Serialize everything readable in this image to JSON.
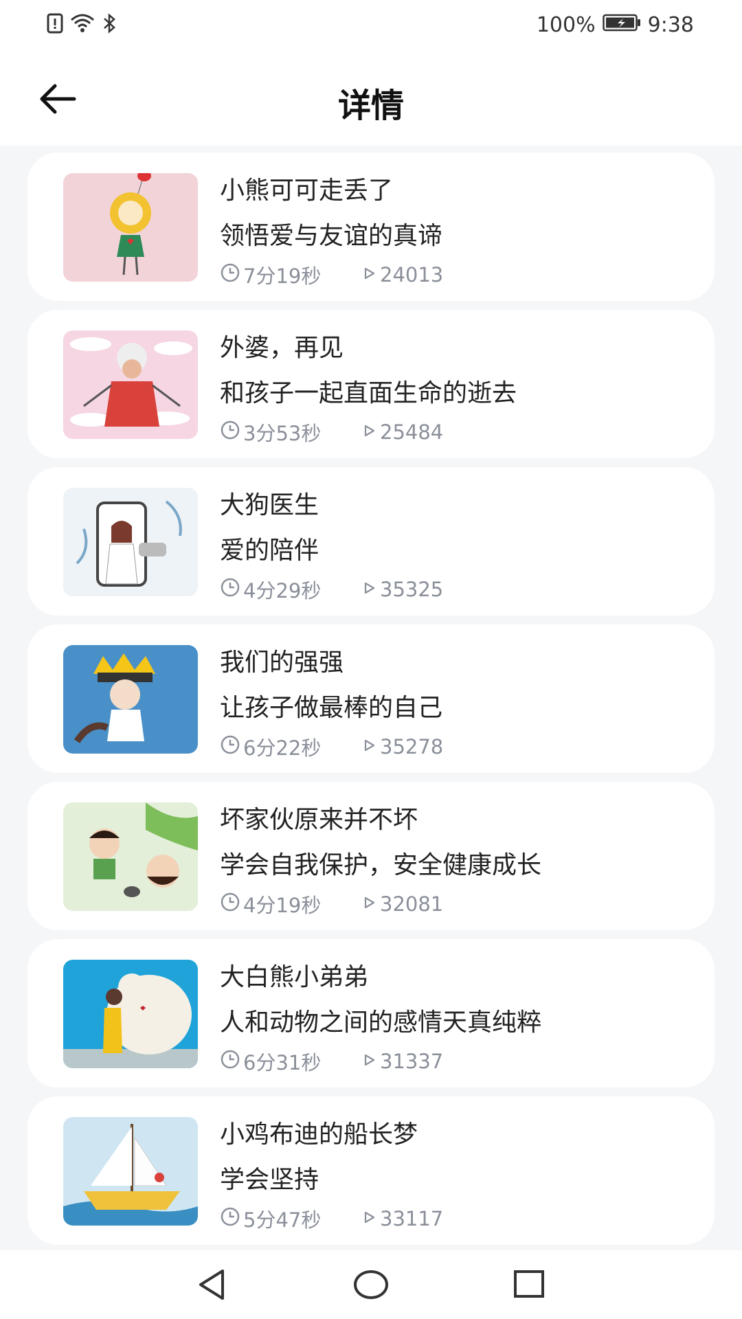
{
  "status_bar": {
    "battery": "100%",
    "time": "9:38",
    "icons": [
      "sim-alert-icon",
      "wifi-icon",
      "bluetooth-icon",
      "battery-icon"
    ]
  },
  "header": {
    "title": "详情",
    "back_icon": "arrow-left-icon"
  },
  "stories": [
    {
      "title": "小熊可可走丢了",
      "subtitle": "领悟爱与友谊的真谛",
      "duration": "7分19秒",
      "plays": "24013"
    },
    {
      "title": "外婆，再见",
      "subtitle": "和孩子一起直面生命的逝去",
      "duration": "3分53秒",
      "plays": "25484"
    },
    {
      "title": "大狗医生",
      "subtitle": "爱的陪伴",
      "duration": "4分29秒",
      "plays": "35325"
    },
    {
      "title": "我们的强强",
      "subtitle": "让孩子做最棒的自己",
      "duration": "6分22秒",
      "plays": "35278"
    },
    {
      "title": "坏家伙原来并不坏",
      "subtitle": "学会自我保护，安全健康成长",
      "duration": "4分19秒",
      "plays": "32081"
    },
    {
      "title": "大白熊小弟弟",
      "subtitle": "人和动物之间的感情天真纯粹",
      "duration": "6分31秒",
      "plays": "31337"
    },
    {
      "title": "小鸡布迪的船长梦",
      "subtitle": "学会坚持",
      "duration": "5分47秒",
      "plays": "33117"
    }
  ],
  "nav_bar": {
    "icons": [
      "back-triangle-icon",
      "home-circle-icon",
      "recents-square-icon"
    ]
  },
  "colors": {
    "background": "#f5f6f8",
    "card": "#ffffff",
    "title_text": "#222222",
    "meta_text": "#8a8f99"
  }
}
